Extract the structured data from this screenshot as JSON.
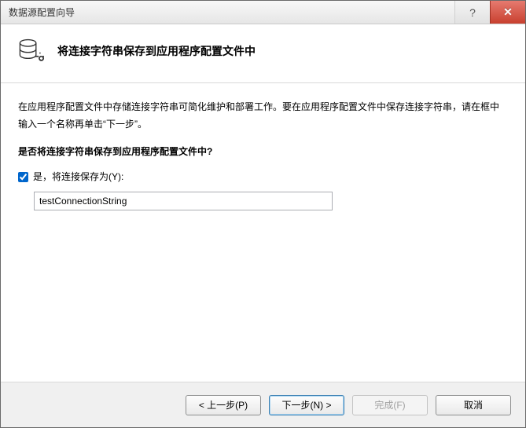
{
  "window": {
    "title": "数据源配置向导",
    "help_symbol": "?",
    "close_symbol": "✕"
  },
  "header": {
    "heading": "将连接字符串保存到应用程序配置文件中"
  },
  "content": {
    "description": "在应用程序配置文件中存储连接字符串可简化维护和部署工作。要在应用程序配置文件中保存连接字符串，请在框中输入一个名称再单击“下一步”。",
    "question": "是否将连接字符串保存到应用程序配置文件中?",
    "checkbox_label": "是，将连接保存为(Y):",
    "checkbox_checked": true,
    "connection_name": "testConnectionString"
  },
  "footer": {
    "back_label": "< 上一步(P)",
    "next_label": "下一步(N) >",
    "finish_label": "完成(F)",
    "cancel_label": "取消"
  }
}
